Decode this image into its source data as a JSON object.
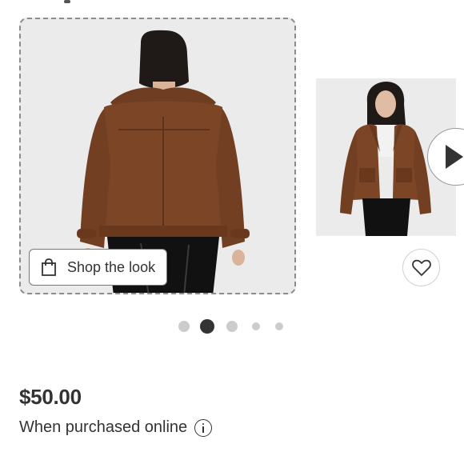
{
  "product": {
    "shop_the_look_label": "Shop the look",
    "price": "$50.00",
    "purchase_note": "When purchased online"
  },
  "gallery": {
    "slide_count": 5,
    "active_slide": 2
  },
  "icons": {
    "shop_look": "shopping-bag-icon",
    "play": "play-icon",
    "favorite": "heart-icon",
    "info": "info-icon"
  },
  "colors": {
    "coat": "#7b4526",
    "image_bg": "#ebebeb",
    "dot_active": "#333333",
    "dot_inactive": "#cccccc",
    "text": "#333333"
  }
}
